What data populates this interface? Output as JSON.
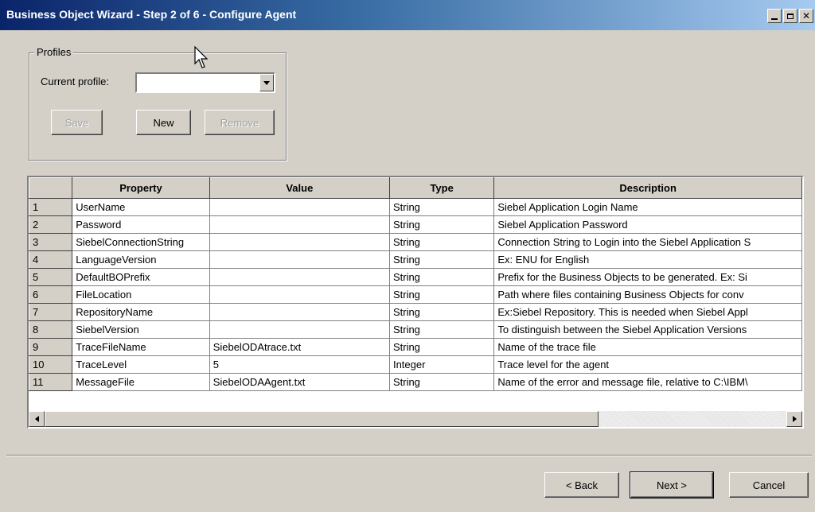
{
  "window": {
    "title": "Business Object Wizard - Step 2 of 6 - Configure Agent"
  },
  "profiles": {
    "legend": "Profiles",
    "current_label": "Current profile:",
    "current_value": "",
    "save_label": "Save",
    "new_label": "New",
    "remove_label": "Remove"
  },
  "table": {
    "headers": [
      "",
      "Property",
      "Value",
      "Type",
      "Description"
    ],
    "rows": [
      {
        "num": "1",
        "property": "UserName",
        "value": "",
        "type": "String",
        "description": "Siebel Application Login Name"
      },
      {
        "num": "2",
        "property": "Password",
        "value": "",
        "type": "String",
        "description": "Siebel Application Password"
      },
      {
        "num": "3",
        "property": "SiebelConnectionString",
        "value": "",
        "type": "String",
        "description": "Connection String to Login into the Siebel Application S"
      },
      {
        "num": "4",
        "property": "LanguageVersion",
        "value": "",
        "type": "String",
        "description": "Ex: ENU for English"
      },
      {
        "num": "5",
        "property": "DefaultBOPrefix",
        "value": "",
        "type": "String",
        "description": "Prefix for the Business Objects to be generated. Ex: Si"
      },
      {
        "num": "6",
        "property": "FileLocation",
        "value": "",
        "type": "String",
        "description": "Path where files containing Business Objects for conv"
      },
      {
        "num": "7",
        "property": "RepositoryName",
        "value": "",
        "type": "String",
        "description": "Ex:Siebel Repository. This is needed when Siebel Appl"
      },
      {
        "num": "8",
        "property": "SiebelVersion",
        "value": "",
        "type": "String",
        "description": "To distinguish between the Siebel Application Versions"
      },
      {
        "num": "9",
        "property": "TraceFileName",
        "value": "SiebelODAtrace.txt",
        "type": "String",
        "description": "Name of the trace file"
      },
      {
        "num": "10",
        "property": "TraceLevel",
        "value": "5",
        "type": "Integer",
        "description": "Trace level for the agent"
      },
      {
        "num": "11",
        "property": "MessageFile",
        "value": "SiebelODAAgent.txt",
        "type": "String",
        "description": "Name of the error and message file, relative to C:\\IBM\\"
      }
    ]
  },
  "footer": {
    "back_label": "< Back",
    "next_label": "Next >",
    "cancel_label": "Cancel"
  },
  "colors": {
    "titlebar_start": "#0a246a",
    "titlebar_end": "#a6caf0",
    "face": "#d4d0c8"
  }
}
